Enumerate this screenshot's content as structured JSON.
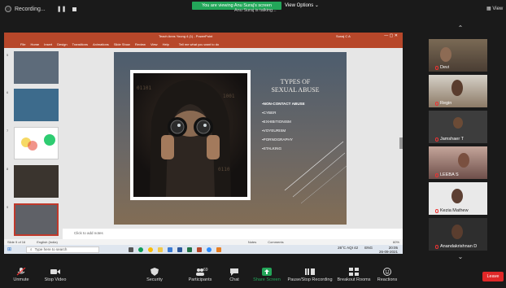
{
  "topbar": {
    "recording_label": "Recording...",
    "viewing_banner": "You are viewing Anu Suraj's screen",
    "talking": "Anu Suraj is talking...",
    "view_options": "View Options",
    "view_button": "View"
  },
  "ppt": {
    "title": "Teach Anns Young 4 (1) - PowerPoint",
    "user": "Sunaj C A",
    "ribbon": [
      "File",
      "Home",
      "Insert",
      "Design",
      "Transitions",
      "Animations",
      "Slide Show",
      "Review",
      "View",
      "Help"
    ],
    "tell_me": "Tell me what you want to do",
    "notes_placeholder": "Click to add notes",
    "status_slide": "Slide 9 of 16",
    "status_lang": "English (India)",
    "status_notes": "Notes",
    "status_comments": "Comments",
    "zoom": "60%",
    "slide": {
      "heading_line1": "TYPES OF",
      "heading_line2": "SEXUAL ABUSE",
      "items": [
        "NON-CONTACT ABUSE",
        "CYBER",
        "EXHIBITIONISM",
        "VOYEURISM",
        "PORNOGRAPHY",
        "STALKING"
      ]
    }
  },
  "taskbar": {
    "search_placeholder": "Type here to search",
    "weather": "26°C AQI 42",
    "lang": "ENG",
    "time": "20:05",
    "date": "26-09-2021"
  },
  "participants": [
    "Devi",
    "Regin",
    "Jamshaer T",
    "LEEBA S",
    "Kezia Mathew",
    "Anandakrishnan D"
  ],
  "toolbar": {
    "unmute": "Unmute",
    "stop_video": "Stop Video",
    "security": "Security",
    "participants": "Participants",
    "participant_count": "69",
    "chat": "Chat",
    "share_screen": "Share Screen",
    "pause_recording": "Pause/Stop Recording",
    "breakout": "Breakout Rooms",
    "reactions": "Reactions",
    "leave": "Leave"
  },
  "colors": {
    "ppt_red": "#b7472a",
    "zoom_green": "#23a659",
    "leave_red": "#e02828",
    "bg": "#1a1a1a"
  }
}
